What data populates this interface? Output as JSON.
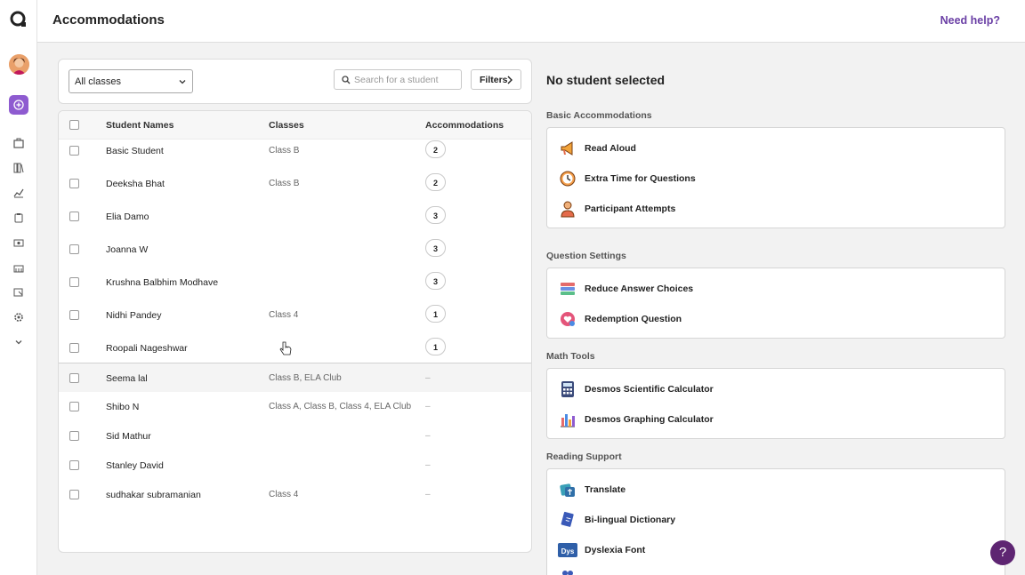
{
  "header": {
    "title": "Accommodations",
    "help_label": "Need help?"
  },
  "filters": {
    "class_select_value": "All classes",
    "search_placeholder": "Search for a student",
    "filters_label": "Filters"
  },
  "table": {
    "headers": {
      "names": "Student Names",
      "classes": "Classes",
      "accommodations": "Accommodations"
    },
    "rows": [
      {
        "name": "Basic Student",
        "classes": "Class B",
        "accommodations": "2"
      },
      {
        "name": "Deeksha Bhat",
        "classes": "Class B",
        "accommodations": "2"
      },
      {
        "name": "Elia Damo",
        "classes": "",
        "accommodations": "3"
      },
      {
        "name": "Joanna W",
        "classes": "",
        "accommodations": "3"
      },
      {
        "name": "Krushna Balbhim Modhave",
        "classes": "",
        "accommodations": "3"
      },
      {
        "name": "Nidhi Pandey",
        "classes": "Class 4",
        "accommodations": "1"
      },
      {
        "name": "Roopali Nageshwar",
        "classes": "",
        "accommodations": "1"
      },
      {
        "name": "Seema lal",
        "classes": "Class B, ELA Club",
        "accommodations": "–"
      },
      {
        "name": "Shibo N",
        "classes": "Class A, Class B, Class 4, ELA Club",
        "accommodations": "–"
      },
      {
        "name": "Sid Mathur",
        "classes": "",
        "accommodations": "–"
      },
      {
        "name": "Stanley David",
        "classes": "",
        "accommodations": "–"
      },
      {
        "name": "sudhakar subramanian",
        "classes": "Class 4",
        "accommodations": "–"
      }
    ]
  },
  "details": {
    "title": "No student selected",
    "sections": [
      {
        "label": "Basic Accommodations",
        "items": [
          "Read Aloud",
          "Extra Time for Questions",
          "Participant Attempts"
        ]
      },
      {
        "label": "Question Settings",
        "items": [
          "Reduce Answer Choices",
          "Redemption Question"
        ]
      },
      {
        "label": "Math Tools",
        "items": [
          "Desmos Scientific Calculator",
          "Desmos Graphing Calculator"
        ]
      },
      {
        "label": "Reading Support",
        "items": [
          "Translate",
          "Bi-lingual Dictionary",
          "Dyslexia Font"
        ]
      }
    ]
  },
  "icons": {
    "dyslexia_font_icon_text": "Dys",
    "help_fab": "?"
  },
  "colors": {
    "accent": "#8e5bd0",
    "link": "#6a3fa5",
    "fab": "#5e2572"
  }
}
